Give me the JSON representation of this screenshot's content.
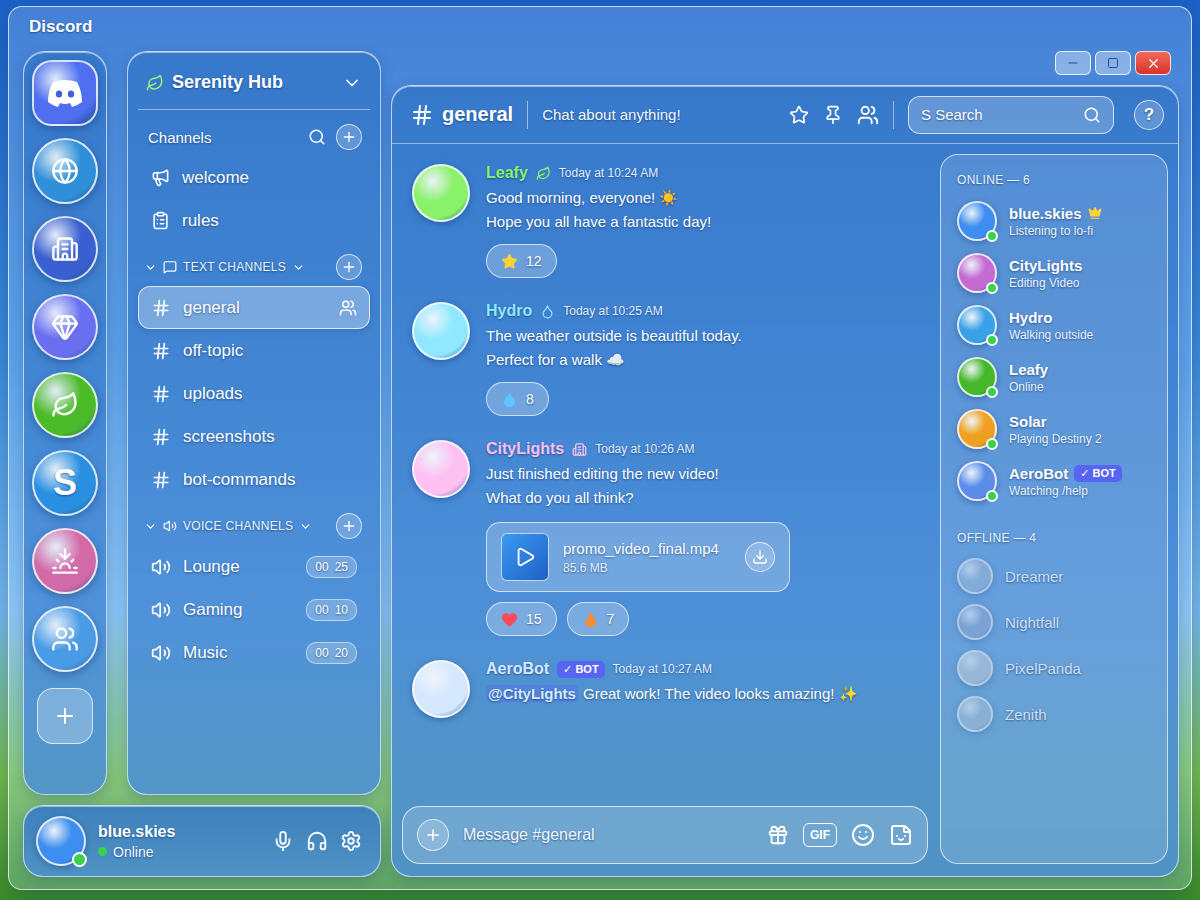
{
  "window": {
    "title": "Discord"
  },
  "servers": [
    {
      "color": "#2f8fd8"
    },
    {
      "color": "#3a5fd0"
    },
    {
      "color": "#6a6ff0"
    },
    {
      "color": "#4cbb2a"
    },
    {
      "color": "#2a8fe0",
      "label": "S"
    },
    {
      "color": "#d26aa8"
    },
    {
      "color": "#4a9be6"
    }
  ],
  "server": {
    "name": "Serenity Hub",
    "channels_label": "Channels"
  },
  "top_channels": [
    {
      "name": "welcome"
    },
    {
      "name": "rules"
    }
  ],
  "categories": [
    {
      "title": "TEXT CHANNELS",
      "kind": "text",
      "expanded": true,
      "channels": [
        {
          "name": "general",
          "selected": true
        },
        {
          "name": "off-topic",
          "selected": false
        },
        {
          "name": "uploads",
          "selected": false
        },
        {
          "name": "screenshots",
          "selected": false
        },
        {
          "name": "bot-commands",
          "selected": false
        }
      ]
    },
    {
      "title": "VOICE CHANNELS",
      "kind": "voice",
      "expanded": true,
      "channels": [
        {
          "name": "Lounge",
          "selected": false,
          "counts": [
            "00",
            "25"
          ]
        },
        {
          "name": "Gaming",
          "selected": false,
          "counts": [
            "00",
            "10"
          ]
        },
        {
          "name": "Music",
          "selected": false,
          "counts": [
            "00",
            "20"
          ]
        }
      ]
    }
  ],
  "user": {
    "name": "blue.skies",
    "status": "Online",
    "color": "#3d8ef0"
  },
  "channel_header": {
    "name": "general",
    "topic": "Chat about anything!"
  },
  "search": {
    "placeholder": "S Search"
  },
  "help": "?",
  "messages": [
    {
      "author": "Leafy",
      "color": "#8af26a",
      "time": "Today at 10:24 AM",
      "lines": [
        "Good morning, everyone! ☀️",
        "Hope you all have a fantastic day!"
      ],
      "reactions": [
        {
          "count": "12"
        }
      ]
    },
    {
      "author": "Hydro",
      "color": "#8fe8ff",
      "time": "Today at 10:25 AM",
      "lines": [
        "The weather outside is beautiful today.",
        "Perfect for a walk ☁️"
      ],
      "reactions": [
        {
          "count": "8"
        }
      ]
    },
    {
      "author": "CityLights",
      "color": "#ffc0f2",
      "time": "Today at 10:26 AM",
      "lines": [
        "Just finished editing the new video!",
        "What do you all think?"
      ],
      "attachment": {
        "name": "promo_video_final.mp4",
        "size": "85.6 MB"
      },
      "reactions": [
        {
          "count": "15"
        },
        {
          "count": "7"
        }
      ]
    },
    {
      "author": "AeroBot",
      "badge": "✓ BOT",
      "color": "#d6e8ff",
      "time": "Today at 10:27 AM",
      "mention": "@CityLights",
      "lines": [
        "Great work! The video looks amazing! ✨"
      ],
      "reactions": []
    }
  ],
  "composer": {
    "placeholder": "Message #general",
    "gif": "GIF"
  },
  "member_groups": [
    {
      "title": "ONLINE — 6",
      "offline": false,
      "members": [
        {
          "name": "blue.skies",
          "status": "Listening to lo-fi",
          "color": "#3d8ef0"
        },
        {
          "name": "CityLights",
          "status": "Editing Video",
          "color": "#c46ad0"
        },
        {
          "name": "Hydro",
          "status": "Walking outside",
          "color": "#3aa0e8"
        },
        {
          "name": "Leafy",
          "status": "Online",
          "color": "#45b82a"
        },
        {
          "name": "Solar",
          "status": "Playing Destiny 2",
          "color": "#f0a020"
        },
        {
          "name": "AeroBot",
          "badge": "✓ BOT",
          "status": "Watching /help",
          "color": "#5b8de8"
        }
      ]
    },
    {
      "title": "OFFLINE — 4",
      "offline": true,
      "members": [
        {
          "name": "Dreamer",
          "color": "#9fb6d6"
        },
        {
          "name": "Nightfall",
          "color": "#8ea6d0"
        },
        {
          "name": "PixelPanda",
          "color": "#c0c8d4"
        },
        {
          "name": "Zenith",
          "color": "#a8bcd8"
        }
      ]
    }
  ]
}
